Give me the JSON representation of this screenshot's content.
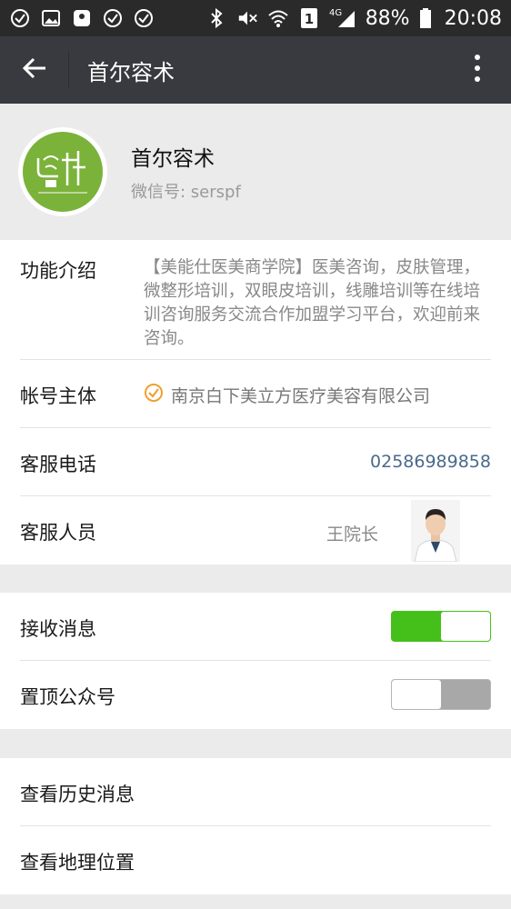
{
  "status_bar": {
    "network_type": "4G",
    "sim_slot": "1",
    "battery_percent": "88%",
    "time": "20:08"
  },
  "title_bar": {
    "title": "首尔容术"
  },
  "profile": {
    "name": "首尔容术",
    "wechat_id": "微信号: serspf"
  },
  "info": {
    "intro_label": "功能介绍",
    "intro_text": "【美能仕医美商学院】医美咨询，皮肤管理，微整形培训，双眼皮培训，线雕培训等在线培训咨询服务交流合作加盟学习平台，欢迎前来咨询。",
    "owner_label": "帐号主体",
    "owner_value": "南京白下美立方医疗美容有限公司",
    "phone_label": "客服电话",
    "phone_value": "02586989858",
    "staff_label": "客服人员",
    "staff_name": "王院长"
  },
  "settings": {
    "receive_label": "接收消息",
    "receive_on": true,
    "pin_label": "置顶公众号",
    "pin_on": false
  },
  "links": {
    "history_label": "查看历史消息",
    "location_label": "查看地理位置"
  },
  "colors": {
    "title_bar_bg": "#393a3f",
    "switch_on": "#45c01a",
    "phone_link": "#4a6a8c",
    "verified_badge": "#f0a030"
  }
}
